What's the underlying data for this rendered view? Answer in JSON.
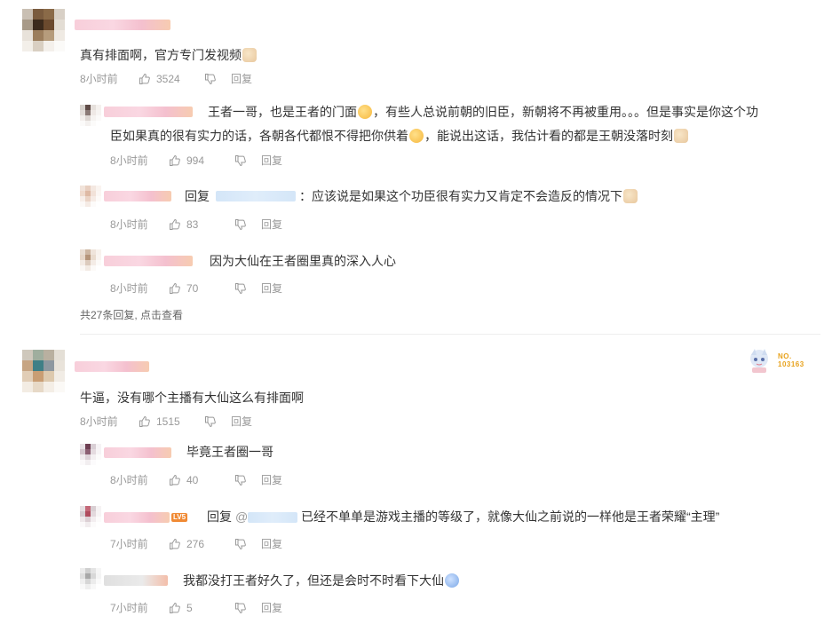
{
  "colors": {
    "text": "#333333",
    "meta": "#999999",
    "divider": "#eeeeee",
    "name_blur": "#f7c9d6",
    "badge": "#e8a21c"
  },
  "threads": [
    {
      "comment": {
        "text": "真有排面啊，官方专门发视频",
        "time": "8小时前",
        "likes": "3524",
        "reply_label": "回复"
      },
      "replies": [
        {
          "text_a": "王者一哥，也是王者的门面",
          "text_b": "，有些人总说前朝的旧臣，新朝将不再被重用。。。但是事实是你这个功",
          "text_c": "臣如果真的很有实力的话，各朝各代都恨不得把你供着",
          "text_d": "，能说出这话，我估计看的都是王朝没落时刻",
          "time": "8小时前",
          "likes": "994",
          "reply_label": "回复"
        },
        {
          "prefix": "回复",
          "text": "：应该说是如果这个功臣很有实力又肯定不会造反的情况下",
          "time": "8小时前",
          "likes": "83",
          "reply_label": "回复"
        },
        {
          "text": "因为大仙在王者圈里真的深入人心",
          "time": "8小时前",
          "likes": "70",
          "reply_label": "回复"
        }
      ],
      "see_more": "共27条回复, 点击查看"
    },
    {
      "badge": {
        "line1": "NO.",
        "line2": "103163"
      },
      "comment": {
        "text": "牛逼，没有哪个主播有大仙这么有排面啊",
        "time": "8小时前",
        "likes": "1515",
        "reply_label": "回复"
      },
      "replies": [
        {
          "text": "毕竟王者圈一哥",
          "time": "8小时前",
          "likes": "40",
          "reply_label": "回复"
        },
        {
          "prefix": "回复",
          "mention": "@",
          "text": "已经不单单是游戏主播的等级了，就像大仙之前说的一样他是王者荣耀“主理”",
          "level": "LV5",
          "time": "7小时前",
          "likes": "276",
          "reply_label": "回复"
        },
        {
          "text": "我都没打王者好久了，但还是会时不时看下大仙",
          "time": "7小时前",
          "likes": "5",
          "reply_label": "回复"
        }
      ]
    }
  ]
}
